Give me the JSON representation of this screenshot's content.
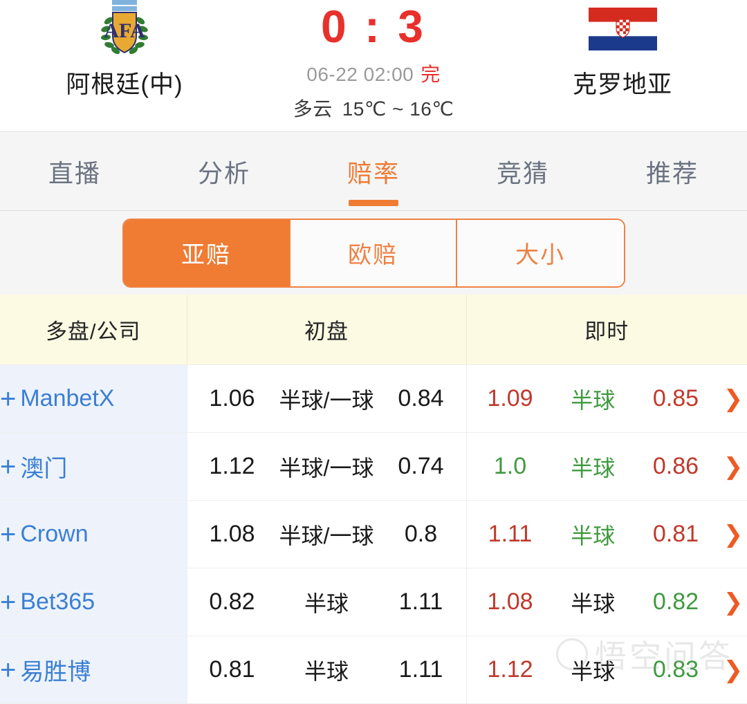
{
  "match": {
    "home_team": "阿根廷(中)",
    "away_team": "克罗地亚",
    "home_crest": "argentina-afa-crest",
    "away_flag": "croatia-flag",
    "score": "0 : 3",
    "datetime": "06-22 02:00",
    "status": "完",
    "weather": "多云",
    "temperature": "15℃ ~ 16℃"
  },
  "tabs": [
    {
      "label": "直播",
      "active": false
    },
    {
      "label": "分析",
      "active": false
    },
    {
      "label": "赔率",
      "active": true
    },
    {
      "label": "竞猜",
      "active": false
    },
    {
      "label": "推荐",
      "active": false
    }
  ],
  "odds_type_tabs": [
    {
      "label": "亚赔",
      "active": true
    },
    {
      "label": "欧赔",
      "active": false
    },
    {
      "label": "大小",
      "active": false
    }
  ],
  "table": {
    "headers": [
      "多盘/公司",
      "初盘",
      "即时"
    ],
    "expand_icon": "plus-icon",
    "detail_icon": "chevron-right-icon",
    "rows": [
      {
        "company": "ManbetX",
        "open_home": "1.06",
        "open_hcap": "半球/一球",
        "open_away": "0.84",
        "live_home": "1.09",
        "live_hcap": "半球",
        "live_away": "0.85",
        "live_home_dir": "up",
        "live_hcap_dir": "down",
        "live_away_dir": "up"
      },
      {
        "company": "澳门",
        "open_home": "1.12",
        "open_hcap": "半球/一球",
        "open_away": "0.74",
        "live_home": "1.0",
        "live_hcap": "半球",
        "live_away": "0.86",
        "live_home_dir": "down",
        "live_hcap_dir": "down",
        "live_away_dir": "up"
      },
      {
        "company": "Crown",
        "open_home": "1.08",
        "open_hcap": "半球/一球",
        "open_away": "0.8",
        "live_home": "1.11",
        "live_hcap": "半球",
        "live_away": "0.81",
        "live_home_dir": "up",
        "live_hcap_dir": "down",
        "live_away_dir": "up"
      },
      {
        "company": "Bet365",
        "open_home": "0.82",
        "open_hcap": "半球",
        "open_away": "1.11",
        "live_home": "1.08",
        "live_hcap": "半球",
        "live_away": "0.82",
        "live_home_dir": "up",
        "live_hcap_dir": "flat",
        "live_away_dir": "down"
      },
      {
        "company": "易胜博",
        "open_home": "0.81",
        "open_hcap": "半球",
        "open_away": "1.11",
        "live_home": "1.12",
        "live_hcap": "半球",
        "live_away": "0.83",
        "live_home_dir": "up",
        "live_hcap_dir": "flat",
        "live_away_dir": "down"
      }
    ]
  },
  "watermark": {
    "text": "悟空问答"
  },
  "colors": {
    "accent_orange": "#f07b33",
    "score_red": "#e8302c",
    "odds_up": "#c0392b",
    "odds_down": "#3f9a3f",
    "company_blue": "#3b7fd4",
    "header_bg": "#fdfae3",
    "company_col_bg": "#eef3fb"
  }
}
